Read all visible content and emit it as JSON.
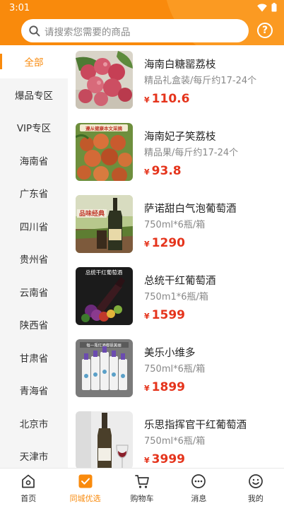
{
  "status_bar": {
    "time": "3:01"
  },
  "search": {
    "placeholder": "请搜索您需要的商品"
  },
  "help": {
    "label": "?"
  },
  "sidebar": {
    "items": [
      {
        "label": "全部",
        "active": true
      },
      {
        "label": "爆品专区"
      },
      {
        "label": "VIP专区"
      },
      {
        "label": "海南省"
      },
      {
        "label": "广东省"
      },
      {
        "label": "四川省"
      },
      {
        "label": "贵州省"
      },
      {
        "label": "云南省"
      },
      {
        "label": "陕西省"
      },
      {
        "label": "甘肃省"
      },
      {
        "label": "青海省"
      },
      {
        "label": "北京市"
      },
      {
        "label": "天津市"
      }
    ]
  },
  "products": [
    {
      "name": "海南白糖罂荔枝",
      "spec": "精品礼盒装/每斤约17-24个",
      "currency": "¥",
      "price": "110.6",
      "image": "lychee-photo"
    },
    {
      "name": "海南妃子笑荔枝",
      "spec": "精品果/每斤约17-24个",
      "currency": "¥",
      "price": "93.8",
      "image": "lychee-pile-photo",
      "image_text": "遵从健康本文采摘"
    },
    {
      "name": "萨诺甜白气泡葡萄酒",
      "spec": "750ml*6瓶/箱",
      "currency": "¥",
      "price": "1290",
      "image": "sparkling-wine-photo",
      "image_text": "品味经典"
    },
    {
      "name": "总统干红葡萄酒",
      "spec": "750m1*6瓶/箱",
      "currency": "¥",
      "price": "1599",
      "image": "red-wine-photo",
      "image_text": "总统干红葡萄酒"
    },
    {
      "name": "美乐小维多",
      "spec": "750ml*6瓶/箱",
      "currency": "¥",
      "price": "1899",
      "image": "wine-bottles-photo",
      "image_text": "每一瓶红酒都很美丽"
    },
    {
      "name": "乐思指挥官干红葡萄酒",
      "spec": "750ml*6瓶/箱",
      "currency": "¥",
      "price": "3999",
      "image": "wine-bottle-glass-photo"
    }
  ],
  "tabbar": {
    "items": [
      {
        "label": "首页",
        "icon": "home-icon"
      },
      {
        "label": "同城优选",
        "icon": "check-square-icon",
        "active": true
      },
      {
        "label": "购物车",
        "icon": "cart-icon"
      },
      {
        "label": "消息",
        "icon": "message-icon"
      },
      {
        "label": "我的",
        "icon": "smile-icon"
      }
    ]
  },
  "colors": {
    "accent": "#f98a0c",
    "price": "#e5341c",
    "sidebar_bg": "#f5f5f5"
  }
}
